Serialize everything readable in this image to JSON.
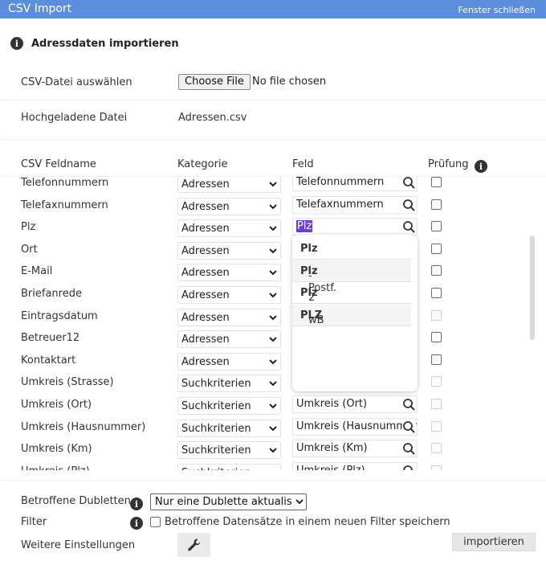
{
  "window": {
    "title": "CSV Import",
    "close_label": "Fenster schließen"
  },
  "section": {
    "title": "Adressdaten importieren"
  },
  "file": {
    "label": "CSV-Datei auswählen",
    "button": "Choose File",
    "status": "No file chosen"
  },
  "uploaded": {
    "label": "Hochgeladene Datei",
    "value": "Adressen.csv"
  },
  "table": {
    "headers": {
      "name": "CSV Feldname",
      "category": "Kategorie",
      "field": "Feld",
      "check": "Prüfung"
    },
    "rows": [
      {
        "name": "Telefonnummern",
        "category": "Adressen",
        "field": "Telefonnummern",
        "check": "enabled"
      },
      {
        "name": "Telefaxnummern",
        "category": "Adressen",
        "field": "Telefaxnummern",
        "check": "enabled"
      },
      {
        "name": "Plz",
        "category": "Adressen",
        "field": "Plz",
        "check": "enabled"
      },
      {
        "name": "Ort",
        "category": "Adressen",
        "field": "",
        "check": "enabled"
      },
      {
        "name": "E-Mail",
        "category": "Adressen",
        "field": "",
        "check": "enabled"
      },
      {
        "name": "Briefanrede",
        "category": "Adressen",
        "field": "",
        "check": "enabled"
      },
      {
        "name": "Eintragsdatum",
        "category": "Adressen",
        "field": "",
        "check": "disabled"
      },
      {
        "name": "Betreuer12",
        "category": "Adressen",
        "field": "",
        "check": "enabled"
      },
      {
        "name": "Kontaktart",
        "category": "Adressen",
        "field": "",
        "check": "enabled"
      },
      {
        "name": "Umkreis (Strasse)",
        "category": "Suchkriterien",
        "field": "",
        "check": "disabled"
      },
      {
        "name": "Umkreis (Ort)",
        "category": "Suchkriterien",
        "field": "Umkreis (Ort)",
        "check": "disabled"
      },
      {
        "name": "Umkreis (Hausnummer)",
        "category": "Suchkriterien",
        "field": "Umkreis (Hausnummer)",
        "check": "disabled"
      },
      {
        "name": "Umkreis (Km)",
        "category": "Suchkriterien",
        "field": "Umkreis (Km)",
        "check": "disabled"
      },
      {
        "name": "Umkreis (Plz)",
        "category": "Suchkriterien",
        "field": "Umkreis (Plz)",
        "check": "disabled"
      }
    ]
  },
  "autocomplete": {
    "items": [
      {
        "pre": "",
        "bold": "Plz",
        "post": ""
      },
      {
        "pre": "",
        "bold": "Plz",
        "post": "-Postf."
      },
      {
        "pre": "",
        "bold": "Plz",
        "post": "2"
      },
      {
        "pre": "wB ",
        "bold": "PLZ",
        "post": ""
      }
    ]
  },
  "duplicates": {
    "label": "Betroffene Dubletten",
    "selected": "Nur eine Dublette aktualisieren"
  },
  "filter": {
    "label": "Filter",
    "checkbox_label": "Betroffene Datensätze in einem neuen Filter speichern"
  },
  "more_settings": {
    "label": "Weitere Einstellungen",
    "icon": "wrench-icon"
  },
  "import_button": "importieren"
}
